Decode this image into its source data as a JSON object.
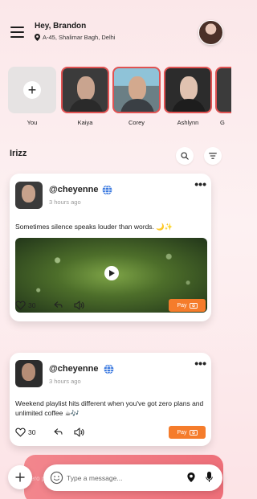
{
  "header": {
    "greeting": "Hey, Brandon",
    "address": "A-45, Shalimar Bagh, Delhi"
  },
  "stories": [
    {
      "name": "You",
      "is_add": true
    },
    {
      "name": "Kaiya",
      "is_add": false
    },
    {
      "name": "Corey",
      "is_add": false
    },
    {
      "name": "Ashlynn",
      "is_add": false
    },
    {
      "name": "G",
      "is_add": false
    }
  ],
  "section": {
    "title": "Irizz"
  },
  "posts": [
    {
      "handle": "@cheyenne",
      "time": "3 hours ago",
      "text": "Sometimes silence speaks louder than words. 🌙✨",
      "likes": "30",
      "pay_label": "Pay",
      "has_media": true
    },
    {
      "handle": "@cheyenne",
      "time": "3 hours ago",
      "text": "Weekend playlist hits different when you've got zero plans and unlimited coffee ☕🎶",
      "likes": "30",
      "pay_label": "Pay",
      "has_media": false
    }
  ],
  "composer": {
    "placeholder": "Type a message...",
    "peek_text": "zero plans"
  },
  "colors": {
    "accent": "#f57c2b",
    "story_border": "#e05252",
    "globe": "#3d7be0"
  },
  "icons": [
    "menu-icon",
    "location-pin-icon",
    "plus-icon",
    "search-icon",
    "filter-icon",
    "globe-icon",
    "more-icon",
    "heart-icon",
    "reply-icon",
    "volume-icon",
    "play-icon",
    "emoji-icon",
    "mic-icon"
  ]
}
